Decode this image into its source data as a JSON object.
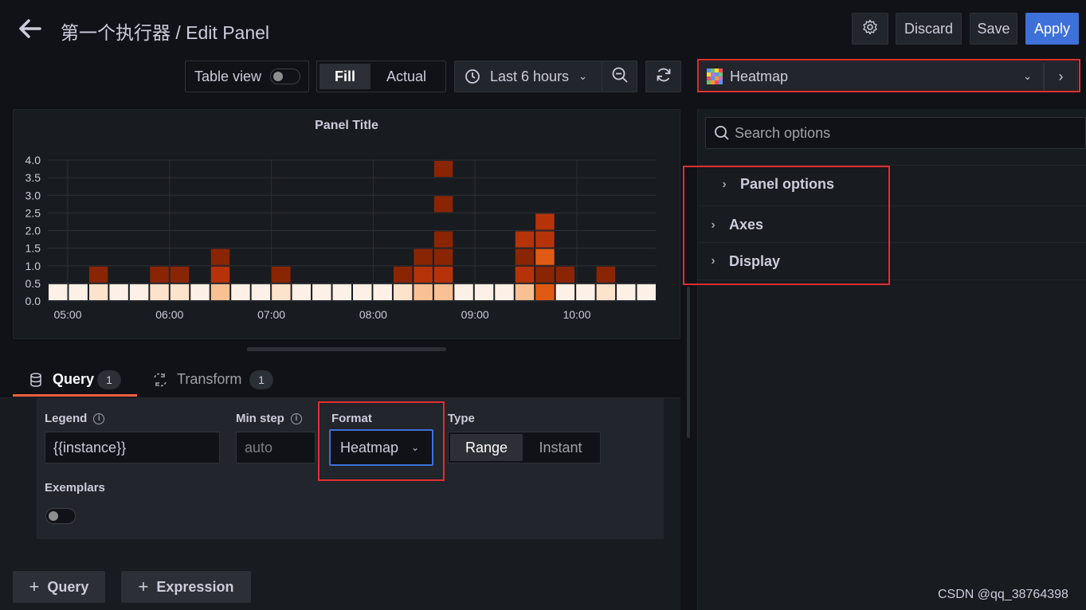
{
  "header": {
    "title": "第一个执行器 / Edit Panel",
    "discard_label": "Discard",
    "save_label": "Save",
    "apply_label": "Apply"
  },
  "toolbar": {
    "table_view_label": "Table view",
    "fill_label": "Fill",
    "actual_label": "Actual",
    "time_range_label": "Last 6 hours"
  },
  "visualization": {
    "selected": "Heatmap",
    "search_placeholder": "Search options",
    "sections": [
      "Panel options",
      "Axes",
      "Display"
    ]
  },
  "panel": {
    "title": "Panel Title"
  },
  "chart_data": {
    "type": "heatmap",
    "title": "Panel Title",
    "y_ticks": [
      "4.0",
      "3.5",
      "3.0",
      "2.5",
      "2.0",
      "1.5",
      "1.0",
      "0.5",
      "0.0"
    ],
    "ylim": [
      0,
      4.0
    ],
    "x_ticks": [
      "05:00",
      "06:00",
      "07:00",
      "08:00",
      "09:00",
      "10:00"
    ],
    "bucket_size": 0.5,
    "columns": 30,
    "cells": [
      {
        "col": 0,
        "y": 0,
        "level": 1
      },
      {
        "col": 1,
        "y": 0,
        "level": 1
      },
      {
        "col": 2,
        "y": 0,
        "level": 2
      },
      {
        "col": 2,
        "y": 0.5,
        "level": 5
      },
      {
        "col": 3,
        "y": 0,
        "level": 1
      },
      {
        "col": 4,
        "y": 0,
        "level": 1
      },
      {
        "col": 5,
        "y": 0,
        "level": 2
      },
      {
        "col": 5,
        "y": 0.5,
        "level": 5
      },
      {
        "col": 6,
        "y": 0,
        "level": 2
      },
      {
        "col": 6,
        "y": 0.5,
        "level": 5
      },
      {
        "col": 7,
        "y": 0,
        "level": 1
      },
      {
        "col": 8,
        "y": 0,
        "level": 3
      },
      {
        "col": 8,
        "y": 0.5,
        "level": 4
      },
      {
        "col": 8,
        "y": 1.0,
        "level": 5
      },
      {
        "col": 9,
        "y": 0,
        "level": 1
      },
      {
        "col": 10,
        "y": 0,
        "level": 1
      },
      {
        "col": 11,
        "y": 0,
        "level": 2
      },
      {
        "col": 11,
        "y": 0.5,
        "level": 5
      },
      {
        "col": 12,
        "y": 0,
        "level": 1
      },
      {
        "col": 13,
        "y": 0,
        "level": 1
      },
      {
        "col": 14,
        "y": 0,
        "level": 1
      },
      {
        "col": 15,
        "y": 0,
        "level": 1
      },
      {
        "col": 16,
        "y": 0,
        "level": 1
      },
      {
        "col": 17,
        "y": 0,
        "level": 2
      },
      {
        "col": 17,
        "y": 0.5,
        "level": 5
      },
      {
        "col": 18,
        "y": 0,
        "level": 3
      },
      {
        "col": 18,
        "y": 0.5,
        "level": 4
      },
      {
        "col": 18,
        "y": 1.0,
        "level": 5
      },
      {
        "col": 19,
        "y": 0,
        "level": 3
      },
      {
        "col": 19,
        "y": 0.5,
        "level": 4
      },
      {
        "col": 19,
        "y": 1.0,
        "level": 5
      },
      {
        "col": 19,
        "y": 1.5,
        "level": 5
      },
      {
        "col": 19,
        "y": 2.5,
        "level": 5
      },
      {
        "col": 19,
        "y": 3.5,
        "level": 5
      },
      {
        "col": 20,
        "y": 0,
        "level": 1
      },
      {
        "col": 21,
        "y": 0,
        "level": 1
      },
      {
        "col": 22,
        "y": 0,
        "level": 1
      },
      {
        "col": 23,
        "y": 0,
        "level": 3
      },
      {
        "col": 23,
        "y": 0.5,
        "level": 4
      },
      {
        "col": 23,
        "y": 1.0,
        "level": 5
      },
      {
        "col": 23,
        "y": 1.5,
        "level": 4
      },
      {
        "col": 24,
        "y": 0,
        "level": 6
      },
      {
        "col": 24,
        "y": 0.5,
        "level": 5
      },
      {
        "col": 24,
        "y": 1.0,
        "level": 6
      },
      {
        "col": 24,
        "y": 1.5,
        "level": 4
      },
      {
        "col": 24,
        "y": 2.0,
        "level": 4
      },
      {
        "col": 25,
        "y": 0,
        "level": 1
      },
      {
        "col": 25,
        "y": 0.5,
        "level": 5
      },
      {
        "col": 26,
        "y": 0,
        "level": 1
      },
      {
        "col": 27,
        "y": 0,
        "level": 2
      },
      {
        "col": 27,
        "y": 0.5,
        "level": 5
      },
      {
        "col": 28,
        "y": 0,
        "level": 1
      },
      {
        "col": 29,
        "y": 0,
        "level": 1
      }
    ],
    "level_colors": {
      "1": "#fdf0e6",
      "2": "#fde2cc",
      "3": "#f9c093",
      "4": "#b6330a",
      "5": "#8a2504",
      "6": "#e05a14"
    }
  },
  "query_tabs": {
    "query_label": "Query",
    "query_count": "1",
    "transform_label": "Transform",
    "transform_count": "1"
  },
  "query_editor": {
    "legend_label": "Legend",
    "legend_value": "{{instance}}",
    "min_step_label": "Min step",
    "min_step_placeholder": "auto",
    "format_label": "Format",
    "format_value": "Heatmap",
    "type_label": "Type",
    "type_range": "Range",
    "type_instant": "Instant",
    "exemplars_label": "Exemplars"
  },
  "footer": {
    "add_query_label": "Query",
    "add_expression_label": "Expression"
  },
  "watermark": "CSDN @qq_38764398",
  "colors": {
    "background": "#111217",
    "panel": "#181b1f",
    "apply_blue": "#3d71d9",
    "highlight_red": "#e02f2f",
    "tab_orange": "#f55f3e"
  }
}
